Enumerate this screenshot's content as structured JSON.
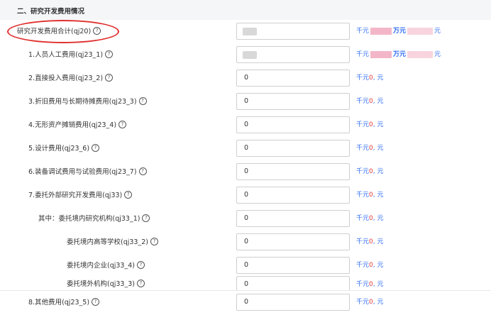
{
  "section": {
    "title": "二、研究开发费用情况"
  },
  "units": {
    "thousand": "千元",
    "wan": "万元",
    "yuan": "元",
    "zero": "0",
    "sep": ","
  },
  "rows": [
    {
      "label": "研究开发费用合计(qj20)",
      "value": "",
      "blurred": true
    },
    {
      "label": "1.人员人工费用(qj23_1)",
      "value": "",
      "blurred": true
    },
    {
      "label": "2.直接投入费用(qj23_2)",
      "value": "0"
    },
    {
      "label": "3.折旧费用与长期待摊费用(qj23_3)",
      "value": "0"
    },
    {
      "label": "4.无形资产摊销费用(qj23_4)",
      "value": "0"
    },
    {
      "label": "5.设计费用(qj23_6)",
      "value": "0"
    },
    {
      "label": "6.装备调试费用与试验费用(qj23_7)",
      "value": "0"
    },
    {
      "label": "7.委托外部研究开发费用(qj33)",
      "value": "0"
    },
    {
      "label": "其中：委托境内研究机构(qj33_1)",
      "value": "0"
    },
    {
      "label": "委托境内高等学校(qj33_2)",
      "value": "0"
    },
    {
      "label": "委托境内企业(qj33_4)",
      "value": "0"
    },
    {
      "label": "委托境外机构(qj33_3)",
      "value": "0"
    },
    {
      "label": "8.其他费用(qj23_5)",
      "value": "0"
    }
  ],
  "help_glyph": "?",
  "colors": {
    "link_blue": "#2f6df4",
    "value_red": "#e23b3b",
    "annotation_red": "#e0312f"
  }
}
